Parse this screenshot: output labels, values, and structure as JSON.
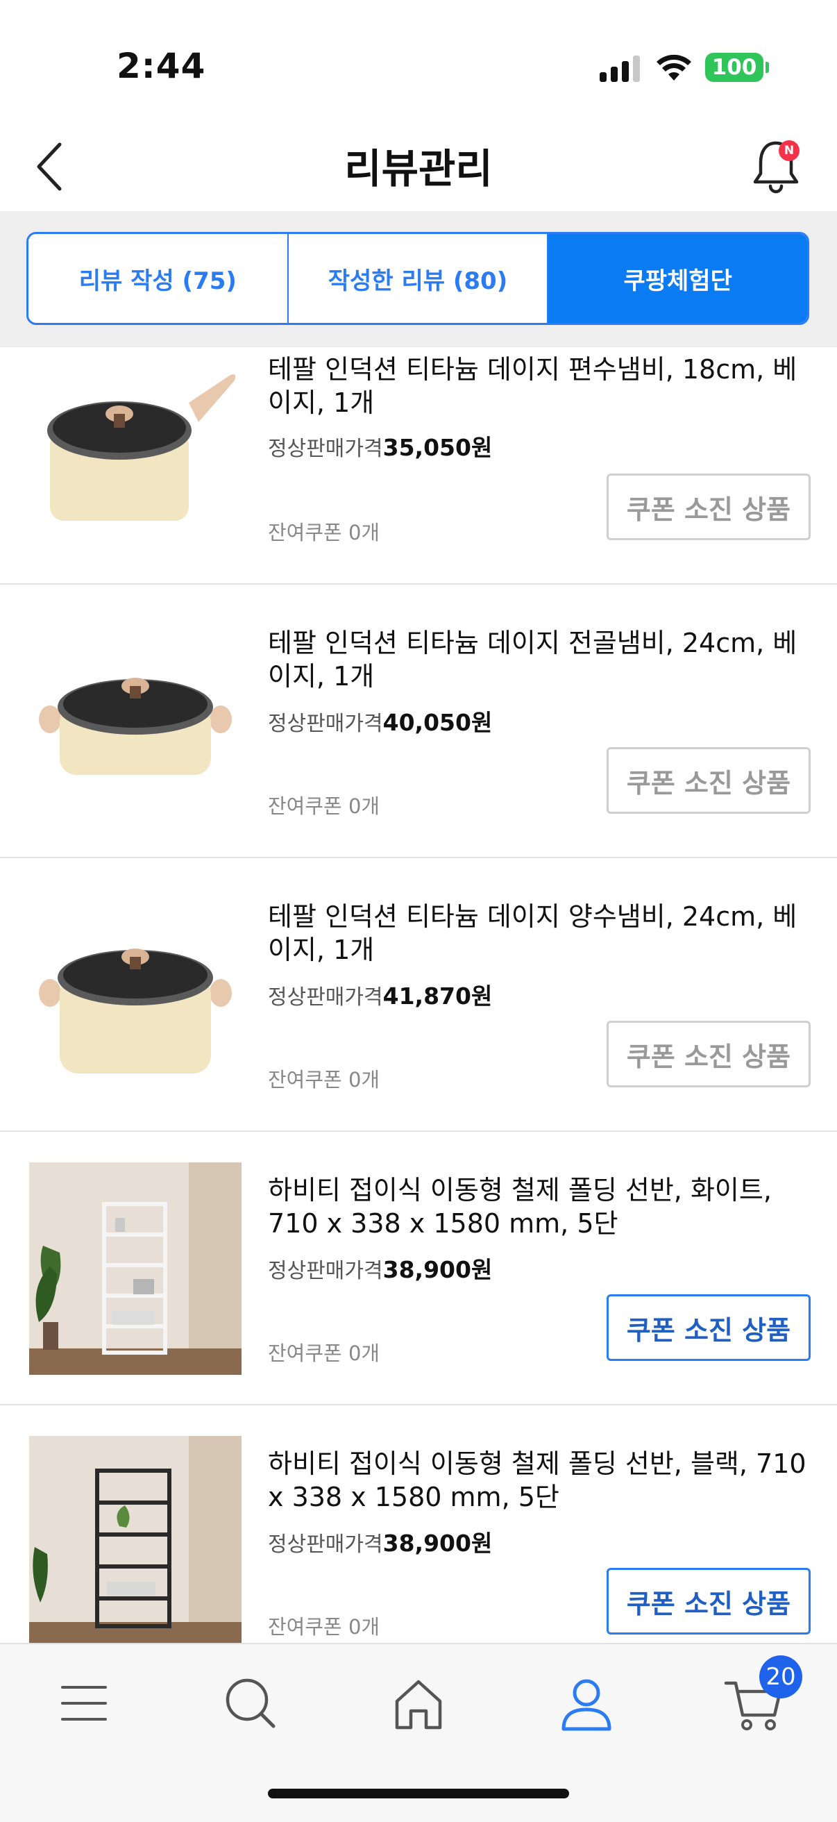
{
  "status_bar": {
    "time": "2:44",
    "battery": "100"
  },
  "header": {
    "title": "리뷰관리",
    "notification_badge": "N"
  },
  "tabs": [
    {
      "label": "리뷰 작성 (75)",
      "active": false
    },
    {
      "label": "작성한 리뷰 (80)",
      "active": false
    },
    {
      "label": "쿠팡체험단",
      "active": true
    }
  ],
  "products": [
    {
      "name": "테팔 인덕션 티타늄 데이지 편수냄비, 18cm, 베이지, 1개",
      "price_label": "정상판매가격",
      "price": "35,050원",
      "coupon_left": "잔여쿠폰 0개",
      "button": "쿠폰 소진 상품",
      "button_enabled": false,
      "image": "saucepan"
    },
    {
      "name": "테팔 인덕션 티타늄 데이지 전골냄비, 24cm, 베이지, 1개",
      "price_label": "정상판매가격",
      "price": "40,050원",
      "coupon_left": "잔여쿠폰 0개",
      "button": "쿠폰 소진 상품",
      "button_enabled": false,
      "image": "casserole-low"
    },
    {
      "name": "테팔 인덕션 티타늄 데이지 양수냄비, 24cm, 베이지, 1개",
      "price_label": "정상판매가격",
      "price": "41,870원",
      "coupon_left": "잔여쿠폰 0개",
      "button": "쿠폰 소진 상품",
      "button_enabled": false,
      "image": "casserole-high"
    },
    {
      "name": "하비티 접이식 이동형 철제 폴딩 선반, 화이트, 710 x 338 x 1580 mm, 5단",
      "price_label": "정상판매가격",
      "price": "38,900원",
      "coupon_left": "잔여쿠폰 0개",
      "button": "쿠폰 소진 상품",
      "button_enabled": true,
      "image": "shelf-white"
    },
    {
      "name": "하비티 접이식 이동형 철제 폴딩 선반, 블랙, 710 x 338 x 1580 mm, 5단",
      "price_label": "정상판매가격",
      "price": "38,900원",
      "coupon_left": "잔여쿠폰 0개",
      "button": "쿠폰 소진 상품",
      "button_enabled": true,
      "image": "shelf-black"
    }
  ],
  "bottom_nav": {
    "items": [
      "menu-icon",
      "search-icon",
      "home-icon",
      "my-account-icon",
      "cart-icon"
    ],
    "active": "my-account-icon",
    "cart_count": "20"
  },
  "colors": {
    "accent": "#0b7bf4",
    "accent_text": "#2b7cf2",
    "badge_red": "#f4334b",
    "battery_green": "#2fc55b"
  }
}
